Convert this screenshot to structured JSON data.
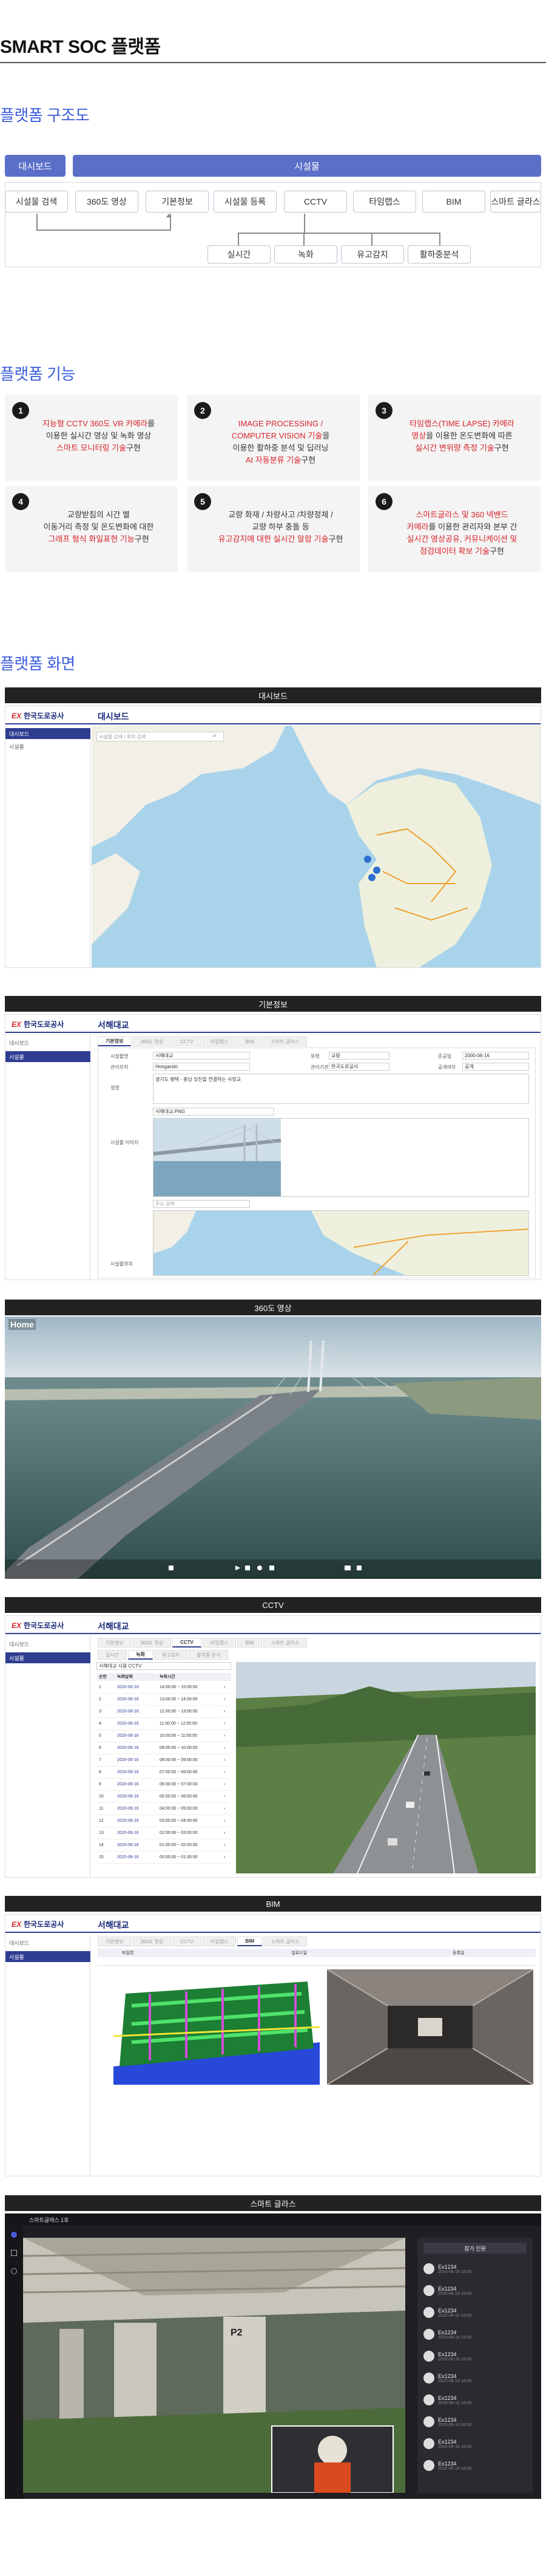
{
  "page_title": "SMART SOC 플랫폼",
  "sections": {
    "structure": "플랫폼 구조도",
    "features": "플랫폼 기능",
    "screens": "플랫폼 화면"
  },
  "structure": {
    "dashboard": "대시보드",
    "facility": "시설물",
    "top_nodes": [
      "시설물 검색",
      "360도 영상",
      "기본정보",
      "시설물 등록",
      "CCTV",
      "타임랩스",
      "BIM",
      "스마트 글라스"
    ],
    "sub_nodes": [
      "실시간",
      "녹화",
      "유고감지",
      "활하중분석"
    ]
  },
  "features": [
    {
      "num": "1",
      "lines": [
        {
          "t": "지능형 CCTV 360도 VR 카메라",
          "red": true,
          "suffix": "를"
        },
        {
          "t": "이용한 실시간 영상 및 녹화 영상"
        },
        {
          "t": "스마트 모니터링 기술",
          "red": true,
          "suffix": "구현"
        }
      ]
    },
    {
      "num": "2",
      "lines": [
        {
          "t": "IMAGE PROCESSING /",
          "red": true
        },
        {
          "t": "COMPUTER VISION 기술",
          "red": true,
          "suffix": "을"
        },
        {
          "t": "이용한 활하중 분석 및 딥러닝"
        },
        {
          "t": "AI 자동분류 기술",
          "red": true,
          "suffix": "구현"
        }
      ]
    },
    {
      "num": "3",
      "lines": [
        {
          "t": "타임랩스(TIME LAPSE) 카메라",
          "red": true
        },
        {
          "t": "영상",
          "red": true,
          "suffix": "을 이용한 온도변화에 따른"
        },
        {
          "t": "실시간 변위량 측정 기술",
          "red": true,
          "suffix": "구현"
        }
      ]
    },
    {
      "num": "4",
      "lines": [
        {
          "t": "교량받침의 시간 별"
        },
        {
          "t": "이동거리 측정 및 온도변화에 대한"
        },
        {
          "t": "그래프 형식 화일표현 기능",
          "red": true,
          "suffix": "구현"
        }
      ]
    },
    {
      "num": "5",
      "lines": [
        {
          "t": "교량 화재 / 차량사고 /차량정체 /"
        },
        {
          "t": "교량 하부 충돌 등"
        },
        {
          "t": "유고감지에 대한 실시간 알람 기술",
          "red": true,
          "suffix": "구현"
        }
      ]
    },
    {
      "num": "6",
      "lines": [
        {
          "t": "스마트글라스 및 360 넥밴드",
          "red": true
        },
        {
          "t": "카메라",
          "red": true,
          "suffix": "를 이용한 관리자와 본부 간"
        },
        {
          "t": "실시간 영상공유, 커뮤니케이션 및",
          "red": true
        },
        {
          "t": "점검데이터 확보 기술",
          "red": true,
          "suffix": "구현"
        }
      ]
    }
  ],
  "screens": {
    "dashboard": {
      "bar": "대시보드",
      "logo_ex": "EX",
      "logo": "한국도로공사",
      "title": "대시보드",
      "side_active": "대시보드",
      "side_items": [
        "시설물"
      ],
      "search_placeholder": "시설물 검색 / 위치 검색"
    },
    "basic": {
      "bar": "기본정보",
      "logo_ex": "EX",
      "logo": "한국도로공사",
      "title": "서해대교",
      "side_items": [
        "대시보드"
      ],
      "side_active": "시설물",
      "tabs": [
        "기본정보",
        "360도 영상",
        "CCTV",
        "타임랩스",
        "BIM",
        "스마트 글라스"
      ],
      "labels": {
        "name": "시설물명",
        "admin": "관리부처",
        "desc": "설명",
        "image": "시설물 이미지",
        "map": "시설물위치",
        "type": "유형",
        "year": "준공일",
        "grade": "등급",
        "org": "관리기관",
        "status": "공개여부"
      },
      "values": {
        "name": "서해대교",
        "admin": "Hongando",
        "type": "교량",
        "year": "2000-06-16",
        "org": "한국도로공사",
        "status": "공개",
        "desc": "경기도 평택 - 충남 당진을 연결하는 사장교",
        "image_file": "서해대교.PNG",
        "map_search": "주소 검색"
      }
    },
    "video360": {
      "bar": "360도 영상",
      "home": "Home"
    },
    "cctv": {
      "bar": "CCTV",
      "logo_ex": "EX",
      "logo": "한국도로공사",
      "title": "서해대교",
      "side_items": [
        "대시보드"
      ],
      "side_active": "시설물",
      "tabs": [
        "기본정보",
        "360도 영상",
        "CCTV",
        "타임랩스",
        "BIM",
        "스마트 글라스"
      ],
      "sub_tabs": [
        "실시간",
        "녹화",
        "유고감지",
        "활하중 분석"
      ],
      "camera_select": "서해대교 사용 CCTV",
      "table_head": [
        "순번",
        "녹화날짜",
        "녹화시간"
      ],
      "rows": [
        [
          "1",
          "2020-06-16",
          "14:00:00 ~ 15:00:00"
        ],
        [
          "2",
          "2020-06-16",
          "13:00:00 ~ 14:00:00"
        ],
        [
          "3",
          "2020-06-16",
          "12:00:00 ~ 13:00:00"
        ],
        [
          "4",
          "2020-06-16",
          "11:00:00 ~ 12:00:00"
        ],
        [
          "5",
          "2020-06-16",
          "10:00:00 ~ 11:00:00"
        ],
        [
          "6",
          "2020-06-16",
          "09:00:00 ~ 10:00:00"
        ],
        [
          "7",
          "2020-06-16",
          "08:00:00 ~ 09:00:00"
        ],
        [
          "8",
          "2020-06-16",
          "07:00:00 ~ 08:00:00"
        ],
        [
          "9",
          "2020-06-16",
          "06:00:00 ~ 07:00:00"
        ],
        [
          "10",
          "2020-06-16",
          "05:00:00 ~ 06:00:00"
        ],
        [
          "11",
          "2020-06-16",
          "04:00:00 ~ 05:00:00"
        ],
        [
          "12",
          "2020-06-16",
          "03:00:00 ~ 04:00:00"
        ],
        [
          "13",
          "2020-06-16",
          "02:00:00 ~ 03:00:00"
        ],
        [
          "14",
          "2020-06-16",
          "01:00:00 ~ 02:00:00"
        ],
        [
          "15",
          "2020-06-16",
          "00:00:00 ~ 01:00:00"
        ]
      ]
    },
    "bim": {
      "bar": "BIM",
      "logo_ex": "EX",
      "logo": "한국도로공사",
      "title": "서해대교",
      "side_items": [
        "대시보드"
      ],
      "side_active": "시설물",
      "tabs": [
        "기본정보",
        "360도 영상",
        "CCTV",
        "타임랩스",
        "BIM",
        "스마트 글라스"
      ],
      "file_head": [
        "파일명",
        "업로드일",
        "등록일"
      ]
    },
    "glass": {
      "bar": "스마트 글라스",
      "app_title": "스마트글래스 1호",
      "panel_title": "참가 인원",
      "participants": [
        {
          "name": "Ex1234",
          "time": "2020-06-16 10:00"
        },
        {
          "name": "Ex1234",
          "time": "2020-06-16 10:00"
        },
        {
          "name": "Ex1234",
          "time": "2020-06-16 10:00"
        },
        {
          "name": "Ex1234",
          "time": "2020-06-16 10:00"
        },
        {
          "name": "Ex1234",
          "time": "2020-06-16 10:00"
        },
        {
          "name": "Ex1234",
          "time": "2020-06-16 10:00"
        },
        {
          "name": "Ex1234",
          "time": "2020-06-16 10:00"
        },
        {
          "name": "Ex1234",
          "time": "2020-06-16 10:00"
        },
        {
          "name": "Ex1234",
          "time": "2020-06-16 10:00"
        },
        {
          "name": "Ex1234",
          "time": "2020-06-16 10:00"
        }
      ],
      "pillar_label": "P2"
    }
  },
  "colors": {
    "accent": "#3b5bdb",
    "red": "#d8232a",
    "navy": "#2f3d91"
  }
}
